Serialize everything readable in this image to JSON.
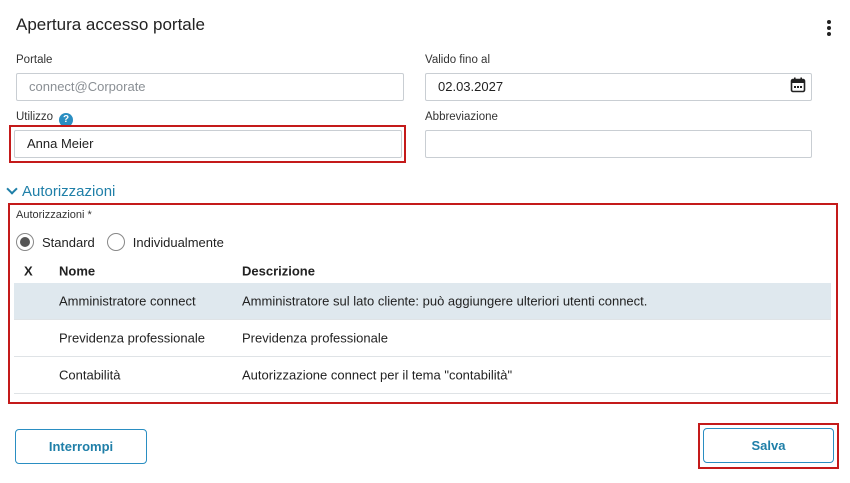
{
  "header": {
    "title": "Apertura accesso portale",
    "menu_icon": "kebab-menu-icon"
  },
  "form": {
    "portale": {
      "label": "Portale",
      "value": "connect@Corporate"
    },
    "valido_fino_al": {
      "label": "Valido fino al",
      "value": "02.03.2027",
      "icon": "calendar-icon"
    },
    "utilizzo": {
      "label": "Utilizzo",
      "help_icon": "?",
      "value": "Anna Meier"
    },
    "abbreviazione": {
      "label": "Abbreviazione",
      "value": ""
    }
  },
  "section": {
    "title": "Autorizzazioni",
    "expanded": true
  },
  "autorizzazioni": {
    "label": "Autorizzazioni *",
    "options": [
      {
        "label": "Standard",
        "checked": true
      },
      {
        "label": "Individualmente",
        "checked": false
      }
    ],
    "columns": [
      "X",
      "Nome",
      "Descrizione"
    ],
    "rows": [
      {
        "name": "Amministratore connect",
        "description": "Amministratore sul lato cliente: può aggiungere ulteriori utenti connect.",
        "checked": false
      },
      {
        "name": "Previdenza professionale",
        "description": "Previdenza professionale",
        "checked": true
      },
      {
        "name": "Contabilità",
        "description": "Autorizzazione connect per il tema \"contabilità\"",
        "checked": true
      }
    ]
  },
  "buttons": {
    "cancel": "Interrompi",
    "save": "Salva"
  },
  "colors": {
    "accent": "#1f7fa8",
    "highlight": "#c41a1a",
    "row_selected": "#dfe8ee"
  }
}
